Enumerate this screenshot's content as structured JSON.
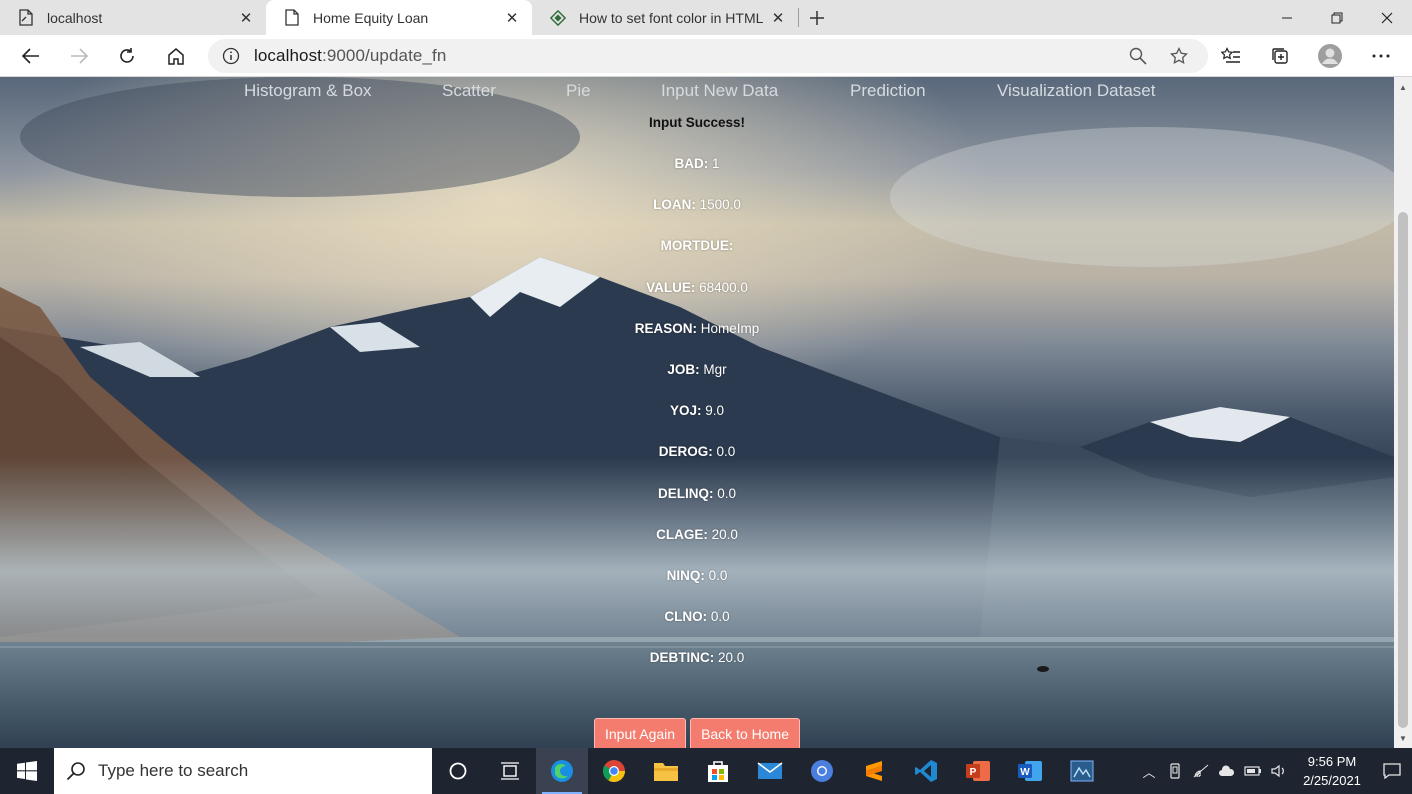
{
  "browser": {
    "tabs": [
      {
        "title": "localhost",
        "icon": "page-icon",
        "active": false
      },
      {
        "title": "Home Equity Loan",
        "icon": "page-icon",
        "active": true
      },
      {
        "title": "How to set font color in HTML?",
        "icon": "site-favicon",
        "active": false
      }
    ],
    "url_host": "localhost",
    "url_path": ":9000/update_fn"
  },
  "nav": {
    "items": [
      "Histogram & Box",
      "Scatter",
      "Pie",
      "Input New Data",
      "Prediction",
      "Visualization Dataset"
    ]
  },
  "result": {
    "heading": "Input Success!",
    "fields": [
      {
        "label": "BAD:",
        "value": "1"
      },
      {
        "label": "LOAN:",
        "value": "1500.0"
      },
      {
        "label": "MORTDUE:",
        "value": ""
      },
      {
        "label": "VALUE:",
        "value": "68400.0"
      },
      {
        "label": "REASON:",
        "value": "HomeImp"
      },
      {
        "label": "JOB:",
        "value": "Mgr"
      },
      {
        "label": "YOJ:",
        "value": "9.0"
      },
      {
        "label": "DEROG:",
        "value": "0.0"
      },
      {
        "label": "DELINQ:",
        "value": "0.0"
      },
      {
        "label": "CLAGE:",
        "value": "20.0"
      },
      {
        "label": "NINQ:",
        "value": "0.0"
      },
      {
        "label": "CLNO:",
        "value": "0.0"
      },
      {
        "label": "DEBTINC:",
        "value": "20.0"
      }
    ],
    "buttons": {
      "input_again": "Input Again",
      "back_home": "Back to Home"
    }
  },
  "taskbar": {
    "search_placeholder": "Type here to search",
    "time": "9:56 PM",
    "date": "2/25/2021"
  },
  "colors": {
    "button_bg": "#f47c6e",
    "taskbar_bg": "#1f2530",
    "chrome_bg": "#e3e3e3"
  }
}
